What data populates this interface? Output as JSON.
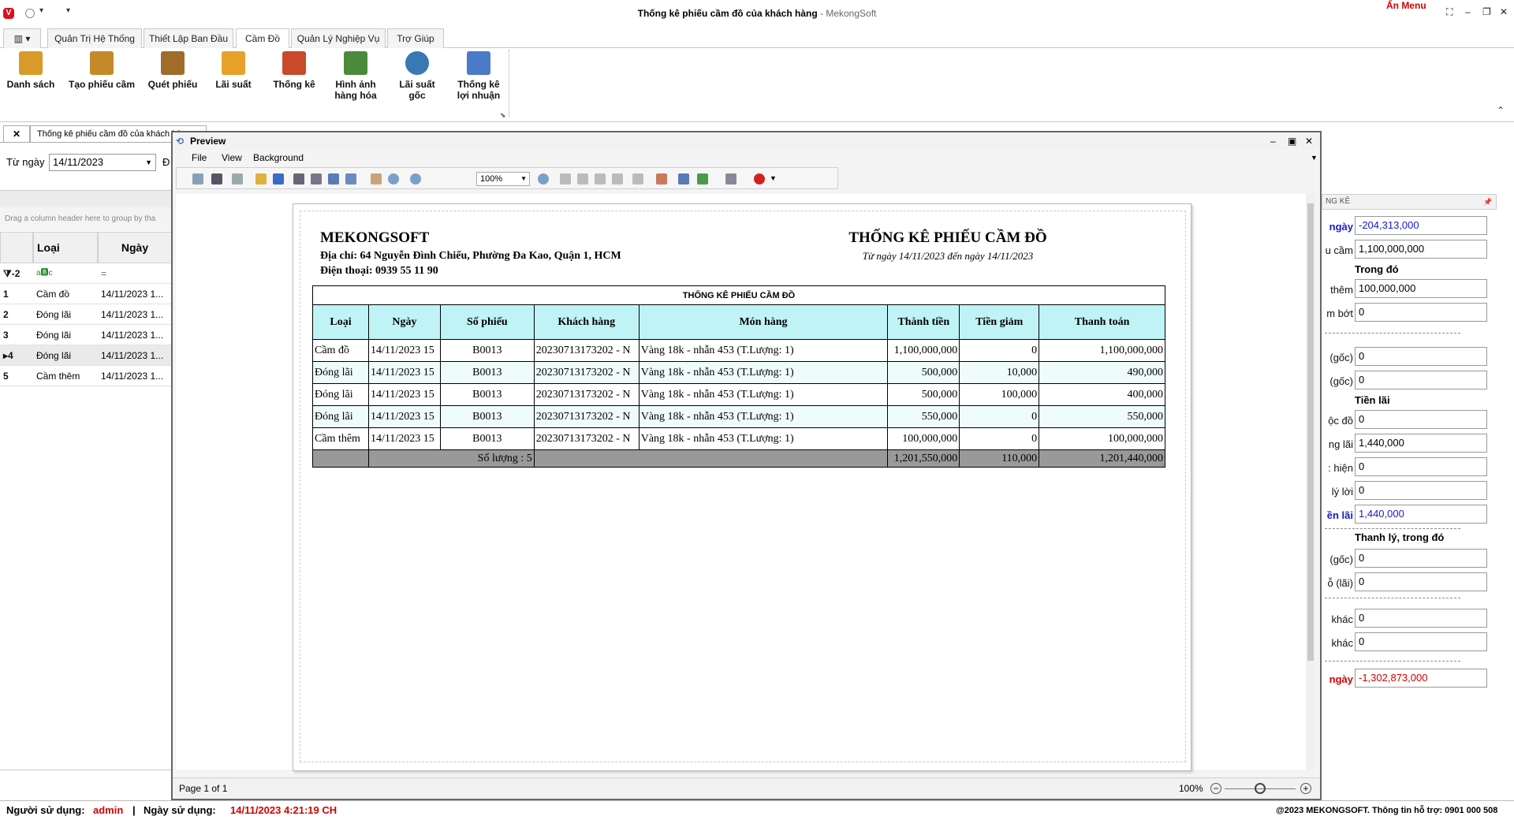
{
  "app": {
    "window_title": "Thống kê phiếu cầm đồ của khách hàng",
    "brand": " - MekongSoft",
    "logo_letter": "V",
    "hide_menu": "Ẩn Menu"
  },
  "ribbon": {
    "tabs": [
      "Quản Trị Hệ Thống",
      "Thiết Lập Ban Đầu",
      "Cầm Đồ",
      "Quản Lý Nghiệp Vụ",
      "Trợ Giúp"
    ],
    "active_tab": "Cầm Đồ",
    "buttons": [
      {
        "label1": "Danh sách",
        "label2": "",
        "icon": "clipboard-icon",
        "color": "#d89b2a"
      },
      {
        "label1": "Tạo phiếu cầm",
        "label2": "",
        "icon": "edit-checklist-icon",
        "color": "#c48a2a"
      },
      {
        "label1": "Quét phiếu",
        "label2": "",
        "icon": "barcode-scan-icon",
        "color": "#a06c2a"
      },
      {
        "label1": "Lãi suất",
        "label2": "",
        "icon": "percent-icon",
        "color": "#e7a12a"
      },
      {
        "label1": "Thống kê",
        "label2": "",
        "icon": "chart-icon",
        "color": "#c84a2a"
      },
      {
        "label1": "Hình ảnh",
        "label2": "hàng hóa",
        "icon": "image-icon",
        "color": "#4b8a3a"
      },
      {
        "label1": "Lãi suất",
        "label2": "gốc",
        "icon": "gauge-icon",
        "color": "#3a78b4"
      },
      {
        "label1": "Thống kê",
        "label2": "lợi nhuận",
        "icon": "spreadsheet-sum-icon",
        "color": "#4a7ac8"
      }
    ]
  },
  "doc_tab": {
    "close": "✕",
    "label": "Thống kê phiếu cầm đồ của khách hàng"
  },
  "filter": {
    "from_label": "Từ ngày",
    "from_value": "14/11/2023",
    "to_label_fragment": "Đ"
  },
  "group_hint": "Drag a column header here to group by tha",
  "grid": {
    "columns": [
      "Loại",
      "Ngày"
    ],
    "filter_row": {
      "num": "-2",
      "c1": "a🅱c",
      "c2": "="
    },
    "rows": [
      {
        "num": "1",
        "type": "Cầm đồ",
        "date": "14/11/2023 1..."
      },
      {
        "num": "2",
        "type": "Đóng lãi",
        "date": "14/11/2023 1..."
      },
      {
        "num": "3",
        "type": "Đóng lãi",
        "date": "14/11/2023 1..."
      },
      {
        "num": "4",
        "type": "Đóng lãi",
        "date": "14/11/2023 1..."
      },
      {
        "num": "5",
        "type": "Cầm thêm",
        "date": "14/11/2023 1..."
      }
    ]
  },
  "preview": {
    "title": "Preview",
    "menu": [
      "File",
      "View",
      "Background"
    ],
    "zoom": "100%",
    "page_info": "Page 1 of 1",
    "zoom_status": "100%",
    "minus": "−",
    "plus": "+"
  },
  "report": {
    "company": "MEKONGSOFT",
    "address": "Địa chỉ: 64 Nguyễn Đình Chiểu, Phường Đa Kao, Quận 1, HCM",
    "phone": "Điện thoại: 0939 55 11 90",
    "title": "THỐNG KÊ PHIẾU CẦM ĐỒ",
    "subtitle": "Từ ngày 14/11/2023 đến ngày 14/11/2023",
    "table_caption": "THỐNG KÊ PHIẾU CẦM ĐỒ",
    "headers": [
      "Loại",
      "Ngày",
      "Số phiếu",
      "Khách hàng",
      "Món hàng",
      "Thành tiền",
      "Tiền giảm",
      "Thanh toán"
    ],
    "rows": [
      [
        "Cầm đồ",
        "14/11/2023 15",
        "B0013",
        "20230713173202 - N",
        "Vàng 18k - nhẫn 453 (T.Lượng: 1)",
        "1,100,000,000",
        "0",
        "1,100,000,000"
      ],
      [
        "Đóng lãi",
        "14/11/2023 15",
        "B0013",
        "20230713173202 - N",
        "Vàng 18k - nhẫn 453 (T.Lượng: 1)",
        "500,000",
        "10,000",
        "490,000"
      ],
      [
        "Đóng lãi",
        "14/11/2023 15",
        "B0013",
        "20230713173202 - N",
        "Vàng 18k - nhẫn 453 (T.Lượng: 1)",
        "500,000",
        "100,000",
        "400,000"
      ],
      [
        "Đóng lãi",
        "14/11/2023 15",
        "B0013",
        "20230713173202 - N",
        "Vàng 18k - nhẫn 453 (T.Lượng: 1)",
        "550,000",
        "0",
        "550,000"
      ],
      [
        "Cầm thêm",
        "14/11/2023 15",
        "B0013",
        "20230713173202 - N",
        "Vàng 18k - nhẫn 453 (T.Lượng: 1)",
        "100,000,000",
        "0",
        "100,000,000"
      ]
    ],
    "totals": {
      "count": "Số lượng : 5",
      "amount": "1,201,550,000",
      "discount": "110,000",
      "paid": "1,201,440,000"
    }
  },
  "stats_panel": {
    "header": "NG KÊ",
    "pin": "📌",
    "fields": [
      {
        "label": "ngày",
        "value": "-204,313,000",
        "color": "#1a1acc"
      },
      {
        "label": "u cầm",
        "value": "1,100,000,000",
        "color": "#000"
      },
      {
        "label": "thêm",
        "value": "100,000,000",
        "color": "#000"
      },
      {
        "label": "m bớt",
        "value": "0",
        "color": "#000"
      },
      {
        "label": "(gốc)",
        "value": "0",
        "color": "#000"
      },
      {
        "label": "(gốc)",
        "value": "0",
        "color": "#000"
      },
      {
        "label": "ộc đồ",
        "value": "0",
        "color": "#000"
      },
      {
        "label": "ng lãi",
        "value": "1,440,000",
        "color": "#000"
      },
      {
        "label": ": hiện",
        "value": "0",
        "color": "#000"
      },
      {
        "label": "lý lời",
        "value": "0",
        "color": "#000"
      },
      {
        "label": "ền lãi",
        "value": "1,440,000",
        "color": "#1a1acc"
      },
      {
        "label": "(gốc)",
        "value": "0",
        "color": "#000"
      },
      {
        "label": "ỗ (lãi)",
        "value": "0",
        "color": "#000"
      },
      {
        "label": "khác",
        "value": "0",
        "color": "#000"
      },
      {
        "label": "khác",
        "value": "0",
        "color": "#000"
      },
      {
        "label": "ngày",
        "value": "-1,302,873,000",
        "color": "#d10000"
      }
    ],
    "section_trong_do": "Trong đó",
    "section_tien_lai": "Tiền lãi",
    "section_thanh_ly": "Thanh lý,  trong đó"
  },
  "status": {
    "user_label": "Người sử dụng:",
    "user": "admin",
    "sep": "|",
    "date_label": "Ngày sử dụng:",
    "date": "14/11/2023 4:21:19 CH",
    "support": "@2023 MEKONGSOFT. Thông tin hỗ trợ: 0901 000 508"
  }
}
